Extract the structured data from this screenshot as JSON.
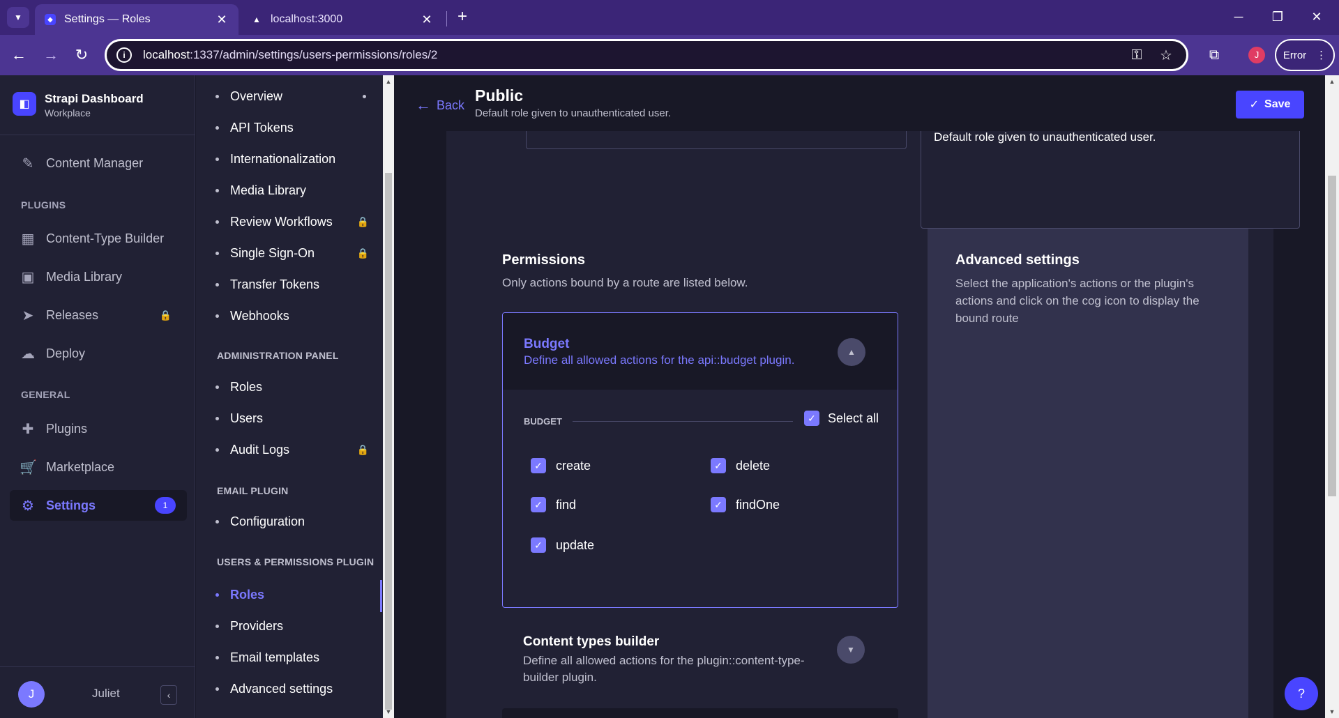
{
  "browser": {
    "tabs": [
      {
        "label": "Settings — Roles",
        "close": "✕"
      },
      {
        "label": "localhost:3000",
        "close": "✕"
      }
    ],
    "new_tab": "+",
    "url_host": "localhost",
    "url_path": ":1337/admin/settings/users-permissions/roles/2",
    "profile_initial": "J",
    "error_label": "Error"
  },
  "brand": {
    "title": "Strapi Dashboard",
    "subtitle": "Workplace"
  },
  "mainnav": {
    "content_manager": "Content Manager",
    "plugins_section": "PLUGINS",
    "content_type_builder": "Content-Type Builder",
    "media_library": "Media Library",
    "releases": "Releases",
    "deploy": "Deploy",
    "general_section": "GENERAL",
    "plugins": "Plugins",
    "marketplace": "Marketplace",
    "settings": "Settings",
    "settings_badge": "1",
    "user_initial": "J",
    "user_name": "Juliet"
  },
  "subnav": {
    "overview": "Overview",
    "api_tokens": "API Tokens",
    "internationalization": "Internationalization",
    "media_library": "Media Library",
    "review_workflows": "Review Workflows",
    "single_sign_on": "Single Sign-On",
    "transfer_tokens": "Transfer Tokens",
    "webhooks": "Webhooks",
    "admin_section": "ADMINISTRATION PANEL",
    "roles": "Roles",
    "users": "Users",
    "audit_logs": "Audit Logs",
    "email_section": "EMAIL PLUGIN",
    "configuration": "Configuration",
    "up_section": "USERS & PERMISSIONS PLUGIN",
    "up_roles": "Roles",
    "providers": "Providers",
    "email_templates": "Email templates",
    "advanced_settings": "Advanced settings"
  },
  "header": {
    "back": "Back",
    "title": "Public",
    "subtitle": "Default role given to unauthenticated user.",
    "save": "Save"
  },
  "form": {
    "description_value": "Default role given to unauthenticated user."
  },
  "permissions": {
    "title": "Permissions",
    "subtitle": "Only actions bound by a route are listed below.",
    "budget": {
      "title": "Budget",
      "description": "Define all allowed actions for the api::budget plugin.",
      "section_label": "BUDGET",
      "select_all": "Select all",
      "actions": [
        "create",
        "delete",
        "find",
        "findOne",
        "update"
      ]
    },
    "ctb": {
      "title": "Content types builder",
      "description": "Define all allowed actions for the plugin::content-type-builder plugin."
    }
  },
  "advanced": {
    "title": "Advanced settings",
    "text": "Select the application's actions or the plugin's actions and click on the cog icon to display the bound route"
  },
  "help": "?",
  "colors": {
    "accent": "#7b79ff",
    "primary": "#4945ff",
    "chrome": "#3b2577"
  }
}
